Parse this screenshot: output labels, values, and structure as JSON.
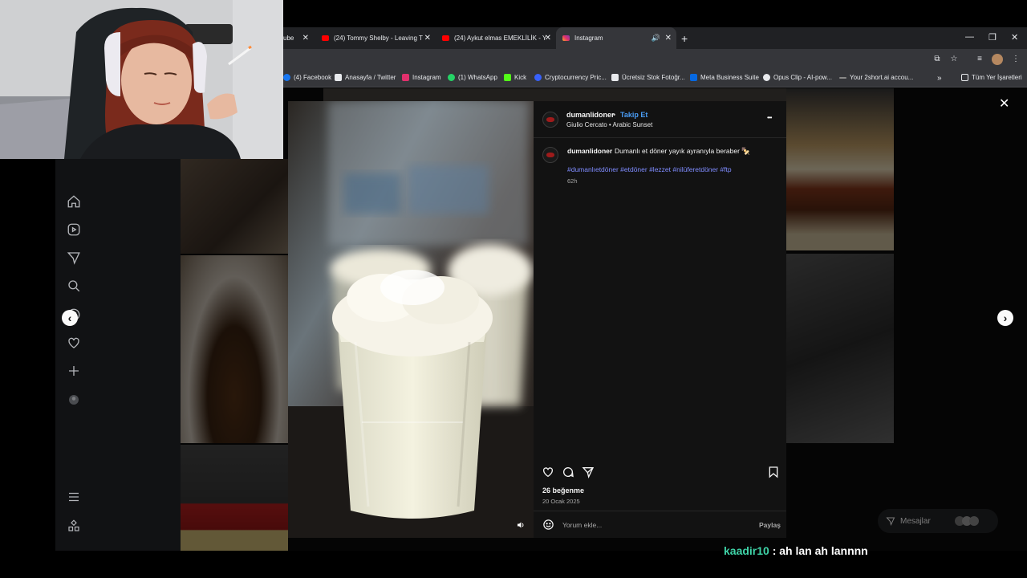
{
  "browser": {
    "tabs": [
      {
        "label": "ube",
        "favicon_color": "#ff0000"
      },
      {
        "label": "(24) Tommy Shelby - Leaving T",
        "favicon_color": "#ff0000"
      },
      {
        "label": "(24) Aykut elmas EMEKLİLİK - Y",
        "favicon_color": "#ff0000"
      },
      {
        "label": "Instagram",
        "favicon_color": "#e1306c"
      }
    ],
    "bookmarks": [
      {
        "label": "(4) Facebook",
        "icon_color": "#1877f2"
      },
      {
        "label": "Anasayfa / Twitter",
        "icon_color": "#e8eaed"
      },
      {
        "label": "Instagram",
        "icon_color": "#e1306c"
      },
      {
        "label": "(1) WhatsApp",
        "icon_color": "#25d366"
      },
      {
        "label": "Kick",
        "icon_color": "#53fc18"
      },
      {
        "label": "Cryptocurrency Pric...",
        "icon_color": "#3861fb"
      },
      {
        "label": "Ücretsiz Stok Fotoğr...",
        "icon_color": "#e8eaed"
      },
      {
        "label": "Meta Business Suite",
        "icon_color": "#0668e1"
      },
      {
        "label": "Opus Clip - AI-pow...",
        "icon_color": "#e8eaed"
      },
      {
        "label": "Your 2short.ai accou...",
        "icon_color": "#888888"
      }
    ],
    "bookmarks_more": "»",
    "all_bookmarks": "Tüm Yer İşaretleri"
  },
  "post": {
    "username": "dumanlidoner",
    "separator": "•",
    "follow_label": "Takip Et",
    "audio": "Giulio Cercato • Arabic Sunset",
    "more_label": "•••",
    "caption_user": "dumanlidoner",
    "caption_text": "Dumanlı et döner yayık ayranıyla beraber 🍢",
    "hashtags": "#dumanlıetdöner #etdöner #lezzet #nilüferetdöner #ftp",
    "age": "62h",
    "likes": "26 beğenme",
    "date": "20 Ocak 2025",
    "comment_placeholder": "Yorum ekle...",
    "share_label": "Paylaş"
  },
  "modal": {
    "close_label": "✕",
    "prev_label": "‹",
    "next_label": "›"
  },
  "messages_label": "Mesajlar",
  "chat": {
    "user": "kaadir10",
    "message": " : ah lan ah lannnn",
    "user_color": "#3fd4a8"
  },
  "colors": {
    "accent": "#7f8cff",
    "follow": "#0095f6",
    "browser_bg": "#35363a"
  }
}
